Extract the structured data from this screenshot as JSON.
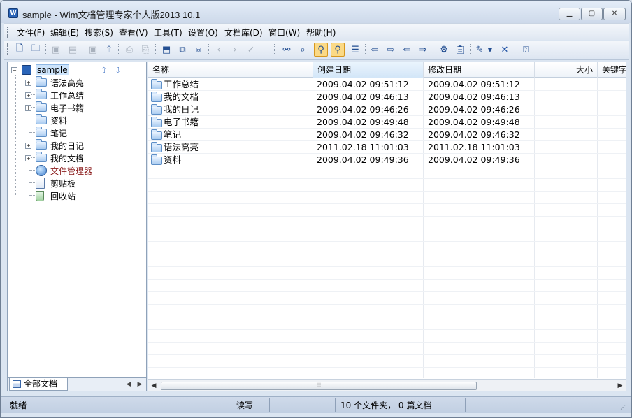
{
  "window": {
    "title": "sample - Wim文档管理专家个人版2013 10.1",
    "icon": "app-logo-icon"
  },
  "menu": [
    "文件(F)",
    "编辑(E)",
    "搜索(S)",
    "查看(V)",
    "工具(T)",
    "设置(O)",
    "文档库(D)",
    "窗口(W)",
    "帮助(H)"
  ],
  "toolbar": {
    "icons": [
      "new-doc-icon",
      "open-folder-icon",
      "save-icon",
      "save-all-icon",
      "disk-icon",
      "export-icon",
      "print-icon",
      "print-preview-icon",
      "import-icon",
      "copy-icon",
      "paste-icon",
      "back-icon",
      "forward-icon",
      "check-icon",
      "binoculars-icon",
      "find-replace-icon",
      "zoom-icon",
      "zoom-active-icon",
      "list-icon",
      "arrow-left-icon",
      "arrow-right-icon",
      "arrow-left-hollow-icon",
      "arrow-right-hollow-icon",
      "properties-icon",
      "clipboard-icon",
      "pen-icon",
      "dropdown-icon",
      "delete-icon",
      "help-icon"
    ],
    "accent": "#fbd985"
  },
  "tree": {
    "root": "sample",
    "items": [
      {
        "label": "语法高亮",
        "expandable": true
      },
      {
        "label": "工作总结",
        "expandable": true
      },
      {
        "label": "电子书籍",
        "expandable": true
      },
      {
        "label": "资料",
        "expandable": false
      },
      {
        "label": "笔记",
        "expandable": false
      },
      {
        "label": "我的日记",
        "expandable": true
      },
      {
        "label": "我的文档",
        "expandable": true
      },
      {
        "label": "文件管理器",
        "expandable": false
      },
      {
        "label": "剪贴板",
        "expandable": false
      },
      {
        "label": "回收站",
        "expandable": false
      }
    ],
    "tab": "全部文档"
  },
  "list": {
    "columns": [
      "名称",
      "创建日期",
      "修改日期",
      "大小",
      "关键字"
    ],
    "rows": [
      {
        "name": "工作总结",
        "created": "2009.04.02 09:51:12",
        "modified": "2009.04.02 09:51:12"
      },
      {
        "name": "我的文档",
        "created": "2009.04.02 09:46:13",
        "modified": "2009.04.02 09:46:13"
      },
      {
        "name": "我的日记",
        "created": "2009.04.02 09:46:26",
        "modified": "2009.04.02 09:46:26"
      },
      {
        "name": "电子书籍",
        "created": "2009.04.02 09:49:48",
        "modified": "2009.04.02 09:49:48"
      },
      {
        "name": "笔记",
        "created": "2009.04.02 09:46:32",
        "modified": "2009.04.02 09:46:32"
      },
      {
        "name": "语法高亮",
        "created": "2011.02.18 11:01:03",
        "modified": "2011.02.18 11:01:03"
      },
      {
        "name": "资料",
        "created": "2009.04.02 09:49:36",
        "modified": "2009.04.02 09:49:36"
      }
    ]
  },
  "status": {
    "state": "就绪",
    "mode": "读写",
    "summary": "10 个文件夹， 0 篇文档"
  }
}
